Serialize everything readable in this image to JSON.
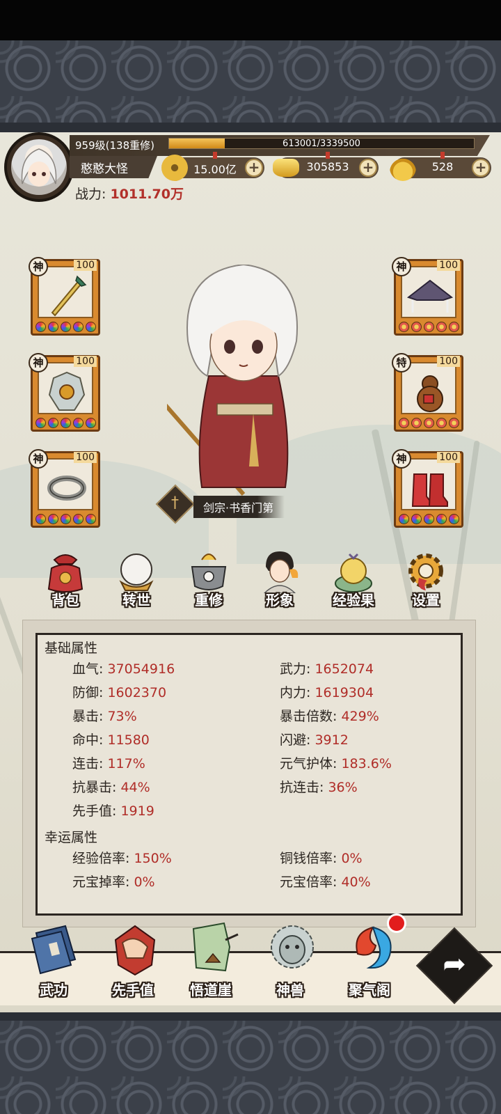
{
  "player": {
    "level_text": "959级(138重修)",
    "exp_text": "613001/3339500",
    "exp_progress": 0.1836,
    "name": "憨憨大怪",
    "power_label": "战力:",
    "power_value": "1011.70万"
  },
  "currencies": [
    {
      "name": "copper-coin",
      "value": "15.00亿"
    },
    {
      "name": "gold-ingot",
      "value": "305853"
    },
    {
      "name": "gourd",
      "value": "528"
    }
  ],
  "currency_add_icon": "+",
  "equipment": [
    {
      "slot": "weapon",
      "tier": "神",
      "level": "100",
      "icon": "sword-icon"
    },
    {
      "slot": "armor",
      "tier": "神",
      "level": "100",
      "icon": "armor-icon"
    },
    {
      "slot": "ring",
      "tier": "神",
      "level": "100",
      "icon": "ring-icon"
    },
    {
      "slot": "hat",
      "tier": "神",
      "level": "100",
      "icon": "hat-icon"
    },
    {
      "slot": "gourd",
      "tier": "特",
      "level": "100",
      "icon": "gourd-icon"
    },
    {
      "slot": "boots",
      "tier": "神",
      "level": "100",
      "icon": "boots-icon"
    }
  ],
  "character_class": "剑宗·书香门第",
  "function_menu": [
    {
      "label": "背包",
      "icon": "bag-icon"
    },
    {
      "label": "转世",
      "icon": "crystal-ball-icon"
    },
    {
      "label": "重修",
      "icon": "cauldron-icon"
    },
    {
      "label": "形象",
      "icon": "portrait-icon"
    },
    {
      "label": "经验果",
      "icon": "exp-fruit-icon"
    },
    {
      "label": "设置",
      "icon": "gear-icon"
    }
  ],
  "stats": {
    "basic_title": "基础属性",
    "basic": [
      {
        "label": "血气:",
        "value": "37054916"
      },
      {
        "label": "武力:",
        "value": "1652074"
      },
      {
        "label": "防御:",
        "value": "1602370"
      },
      {
        "label": "内力:",
        "value": "1619304"
      },
      {
        "label": "暴击:",
        "value": "73%"
      },
      {
        "label": "暴击倍数:",
        "value": "429%"
      },
      {
        "label": "命中:",
        "value": "11580"
      },
      {
        "label": "闪避:",
        "value": "3912"
      },
      {
        "label": "连击:",
        "value": "117%"
      },
      {
        "label": "元气护体:",
        "value": "183.6%"
      },
      {
        "label": "抗暴击:",
        "value": "44%"
      },
      {
        "label": "抗连击:",
        "value": "36%"
      },
      {
        "label": "先手值:",
        "value": "1919"
      }
    ],
    "luck_title": "幸运属性",
    "luck": [
      {
        "label": "经验倍率:",
        "value": "150%"
      },
      {
        "label": "铜钱倍率:",
        "value": "0%"
      },
      {
        "label": "元宝掉率:",
        "value": "0%"
      },
      {
        "label": "元宝倍率:",
        "value": "40%"
      }
    ]
  },
  "bottom_nav": [
    {
      "label": "武功",
      "icon": "book-icon"
    },
    {
      "label": "先手值",
      "icon": "fist-icon"
    },
    {
      "label": "悟道崖",
      "icon": "cliff-icon"
    },
    {
      "label": "神兽",
      "icon": "beast-icon"
    },
    {
      "label": "聚气阁",
      "icon": "flame-swirl-icon"
    }
  ],
  "next_button_icon": "arrow-right-icon",
  "colors": {
    "stat_value": "#b02d28",
    "power_value": "#b2302a",
    "exp_fill": "#e5a43a",
    "frame_orange": "#d98a2f"
  }
}
